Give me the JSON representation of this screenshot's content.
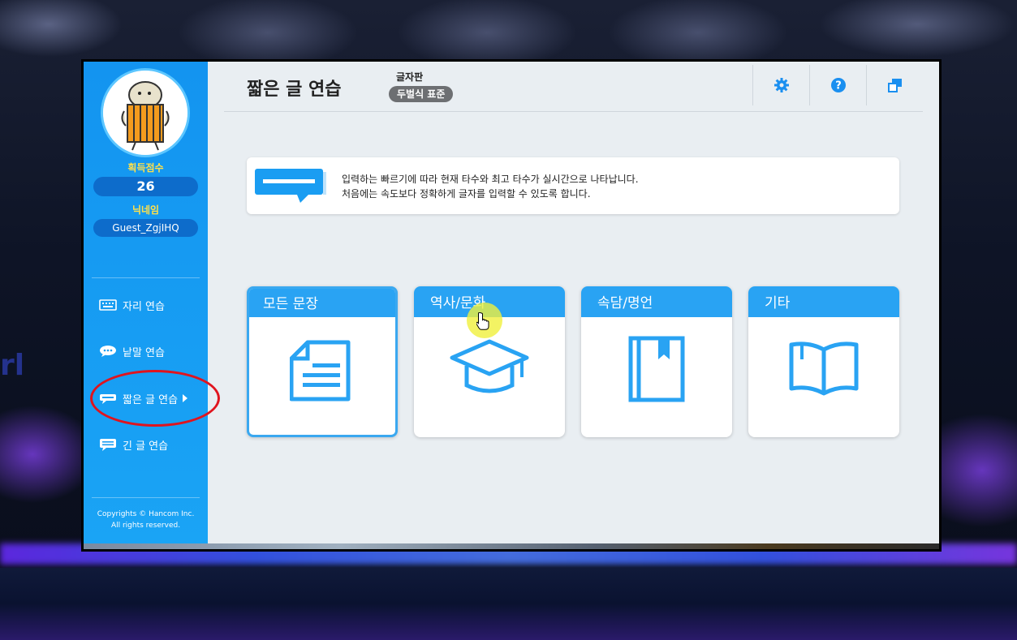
{
  "sidebar": {
    "score_label": "획득점수",
    "score_value": "26",
    "nickname_label": "닉네임",
    "nickname_value": "Guest_ZgjIHQ",
    "menu": [
      {
        "label": "자리 연습",
        "icon": "keyboard-icon"
      },
      {
        "label": "낱말 연습",
        "icon": "speech-bubble-icon"
      },
      {
        "label": "짧은 글 연습",
        "icon": "short-text-icon",
        "active": true
      },
      {
        "label": "긴 글 연습",
        "icon": "long-text-icon"
      }
    ],
    "copyright_line1": "Copyrights © Hancom Inc.",
    "copyright_line2": "All rights reserved."
  },
  "header": {
    "title": "짧은 글 연습",
    "keyboard_label": "글자판",
    "keyboard_value": "두벌식 표준",
    "buttons": [
      "gear-icon",
      "help-icon",
      "window-icon"
    ]
  },
  "banner": {
    "line1": "입력하는 빠르기에 따라 현재 타수와 최고 타수가 실시간으로 나타납니다.",
    "line2": "처음에는 속도보다 정확하게 글자를 입력할 수 있도록 합니다."
  },
  "categories": [
    {
      "label": "모든 문장",
      "icon": "document-icon",
      "selected": true
    },
    {
      "label": "역사/문화",
      "icon": "graduation-cap-icon"
    },
    {
      "label": "속담/명언",
      "icon": "book-bookmark-icon"
    },
    {
      "label": "기타",
      "icon": "open-book-icon"
    }
  ],
  "colors": {
    "accent": "#29a3f3",
    "sidebar": "#1394f0",
    "highlight": "#e0141e",
    "score_label": "#ffe04a"
  }
}
